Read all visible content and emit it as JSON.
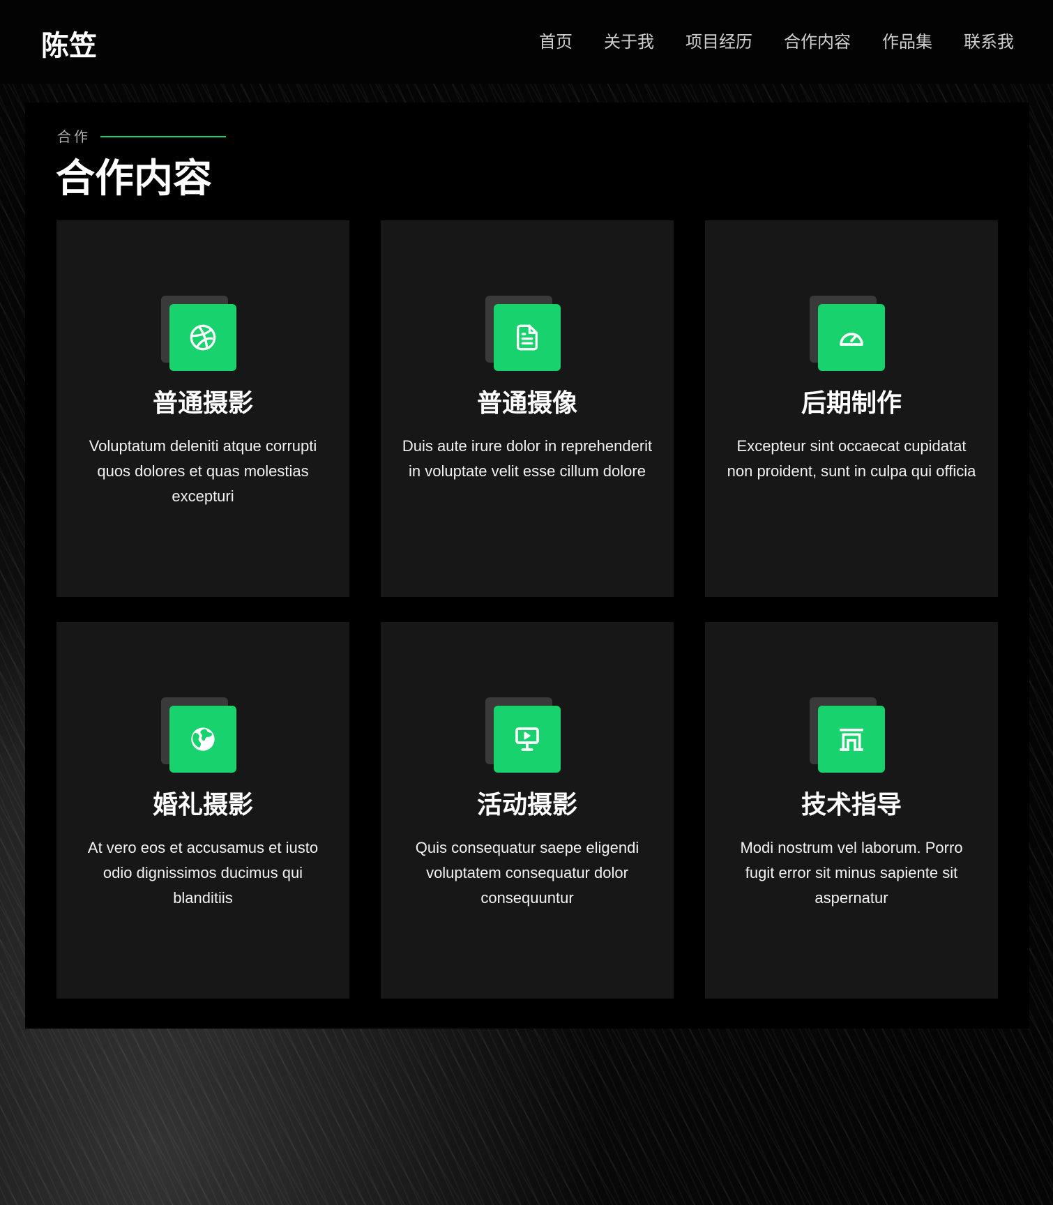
{
  "header": {
    "logo": "陈笠",
    "nav": [
      "首页",
      "关于我",
      "项目经历",
      "合作内容",
      "作品集",
      "联系我"
    ]
  },
  "section": {
    "eyebrow": "合作",
    "title": "合作内容"
  },
  "accent_color": "#18d26e",
  "cards": [
    {
      "icon": "dribbble-icon",
      "title": "普通摄影",
      "desc": "Voluptatum deleniti atque corrupti quos dolores et quas molestias excepturi"
    },
    {
      "icon": "document-icon",
      "title": "普通摄像",
      "desc": "Duis aute irure dolor in reprehenderit in voluptate velit esse cillum dolore"
    },
    {
      "icon": "speedometer-icon",
      "title": "后期制作",
      "desc": "Excepteur sint occaecat cupidatat non proident, sunt in culpa qui officia"
    },
    {
      "icon": "globe-icon",
      "title": "婚礼摄影",
      "desc": "At vero eos et accusamus et iusto odio dignissimos ducimus qui blanditiis"
    },
    {
      "icon": "presentation-icon",
      "title": "活动摄影",
      "desc": "Quis consequatur saepe eligendi voluptatem consequatur dolor consequuntur"
    },
    {
      "icon": "archway-icon",
      "title": "技术指导",
      "desc": "Modi nostrum vel laborum. Porro fugit error sit minus sapiente sit aspernatur"
    }
  ]
}
